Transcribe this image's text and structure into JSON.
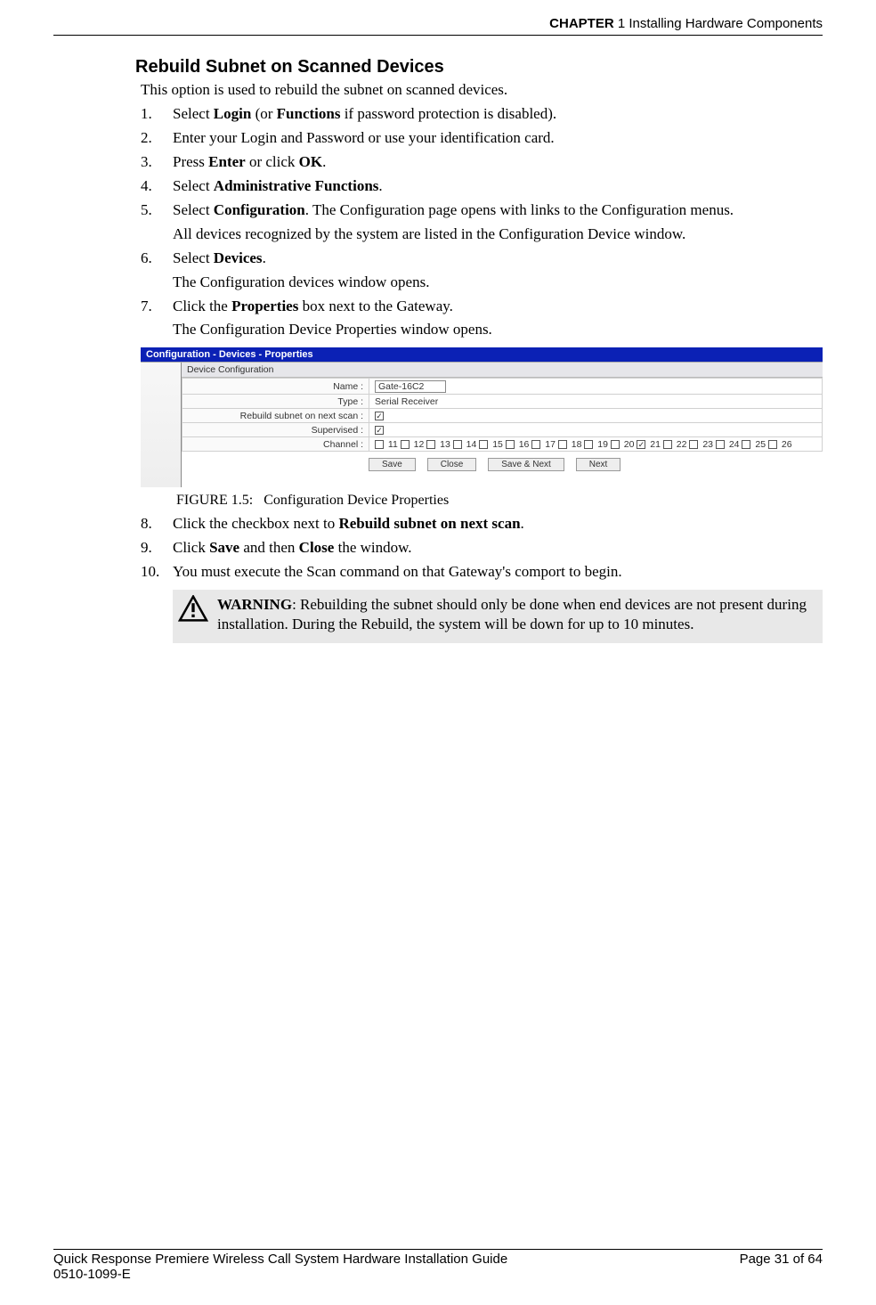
{
  "header": {
    "chapter_prefix": "CHAPTER",
    "chapter_num": "1",
    "chapter_title": "Installing Hardware Components"
  },
  "section": {
    "heading": "Rebuild Subnet on Scanned Devices",
    "intro": "This option is used to rebuild the subnet on scanned devices."
  },
  "steps": [
    {
      "n": "1.",
      "pre": "Select ",
      "b1": "Login",
      "mid1": " (or ",
      "b2": "Functions",
      "post": " if password protection is disabled)."
    },
    {
      "n": "2.",
      "text": "Enter your Login and Password or use your identification card."
    },
    {
      "n": "3.",
      "pre": "Press ",
      "b1": "Enter",
      "mid1": " or click ",
      "b2": "OK",
      "post": "."
    },
    {
      "n": "4.",
      "pre": "Select ",
      "b1": "Administrative Functions",
      "post": "."
    },
    {
      "n": "5.",
      "pre": "Select ",
      "b1": "Configuration",
      "post": ". The Configuration page opens with links to the Configuration menus.",
      "sub": "All devices recognized by the system are listed in the Configuration Device window."
    },
    {
      "n": "6.",
      "pre": "Select ",
      "b1": "Devices",
      "post": ".",
      "sub": "The Configuration devices window opens."
    },
    {
      "n": "7.",
      "pre": "Click the ",
      "b1": "Properties",
      "post": " box next to the Gateway.",
      "sub": "The Configuration Device Properties window opens."
    }
  ],
  "figure": {
    "titlebar": "Configuration - Devices - Properties",
    "legend": "Device Configuration",
    "rows": {
      "name_label": "Name :",
      "name_value": "Gate-16C2",
      "type_label": "Type :",
      "type_value": "Serial Receiver",
      "rebuild_label": "Rebuild subnet on next scan :",
      "supervised_label": "Supervised :",
      "channel_label": "Channel :"
    },
    "channels": [
      {
        "n": "11",
        "c": false
      },
      {
        "n": "12",
        "c": false
      },
      {
        "n": "13",
        "c": false
      },
      {
        "n": "14",
        "c": false
      },
      {
        "n": "15",
        "c": false
      },
      {
        "n": "16",
        "c": false
      },
      {
        "n": "17",
        "c": false
      },
      {
        "n": "18",
        "c": false
      },
      {
        "n": "19",
        "c": false
      },
      {
        "n": "20",
        "c": false
      },
      {
        "n": "21",
        "c": true
      },
      {
        "n": "22",
        "c": false
      },
      {
        "n": "23",
        "c": false
      },
      {
        "n": "24",
        "c": false
      },
      {
        "n": "25",
        "c": false
      },
      {
        "n": "26",
        "c": false
      }
    ],
    "buttons": {
      "save": "Save",
      "close": "Close",
      "savenext": "Save & Next",
      "next": "Next"
    },
    "caption_prefix": "FIGURE 1.5:",
    "caption_text": "Configuration Device Properties"
  },
  "steps2": [
    {
      "n": "8.",
      "pre": "Click the checkbox next to ",
      "b1": "Rebuild subnet on next scan",
      "post": "."
    },
    {
      "n": "9.",
      "pre": "Click ",
      "b1": "Save",
      "mid1": " and then ",
      "b2": "Close",
      "post": " the window."
    },
    {
      "n": "10.",
      "text": "You must execute the Scan command on that Gateway's comport to begin."
    }
  ],
  "warning": {
    "label": "WARNING",
    "text": ": Rebuilding the subnet should only be done when end devices are not present during installation. During the Rebuild, the system will be down for up to 10 minutes."
  },
  "footer": {
    "title": "Quick Response Premiere Wireless Call System Hardware Installation Guide",
    "page": "Page 31 of 64",
    "docid": "0510-1099-E"
  }
}
